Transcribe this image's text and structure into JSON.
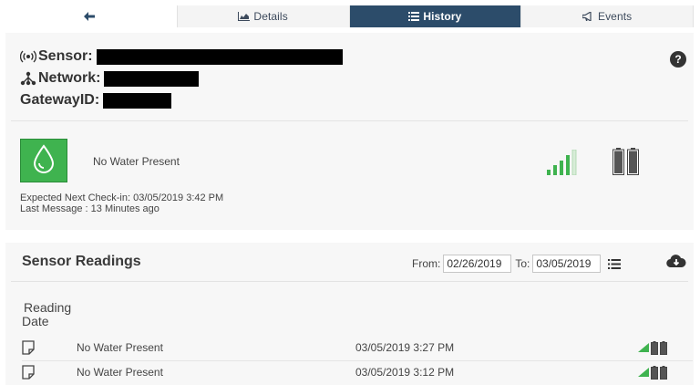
{
  "tabs": [
    {
      "label": "",
      "icon": "back-arrow-icon"
    },
    {
      "label": "Details",
      "icon": "area-chart-icon"
    },
    {
      "label": "History",
      "icon": "list-icon",
      "active": true
    },
    {
      "label": "Events",
      "icon": "bullhorn-icon"
    }
  ],
  "sensor_info": {
    "sensor_label": "Sensor:",
    "network_label": "Network:",
    "gateway_label": "GatewayID:"
  },
  "status": {
    "text": "No Water Present",
    "checkin": "Expected Next Check-in: 03/05/2019 3:42 PM",
    "last_message": "Last Message : 13 Minutes ago",
    "signal_bars": 4,
    "signal_total": 5,
    "accent_color": "#3fb34f"
  },
  "readings": {
    "title": "Sensor Readings",
    "from_label": "From:",
    "from_value": "02/26/2019",
    "to_label": "To:",
    "to_value": "03/05/2019",
    "column_header_line1": "Reading",
    "column_header_line2": "Date",
    "rows": [
      {
        "message": "No Water Present",
        "date": "03/05/2019 3:27 PM"
      },
      {
        "message": "No Water Present",
        "date": "03/05/2019 3:12 PM"
      }
    ]
  }
}
